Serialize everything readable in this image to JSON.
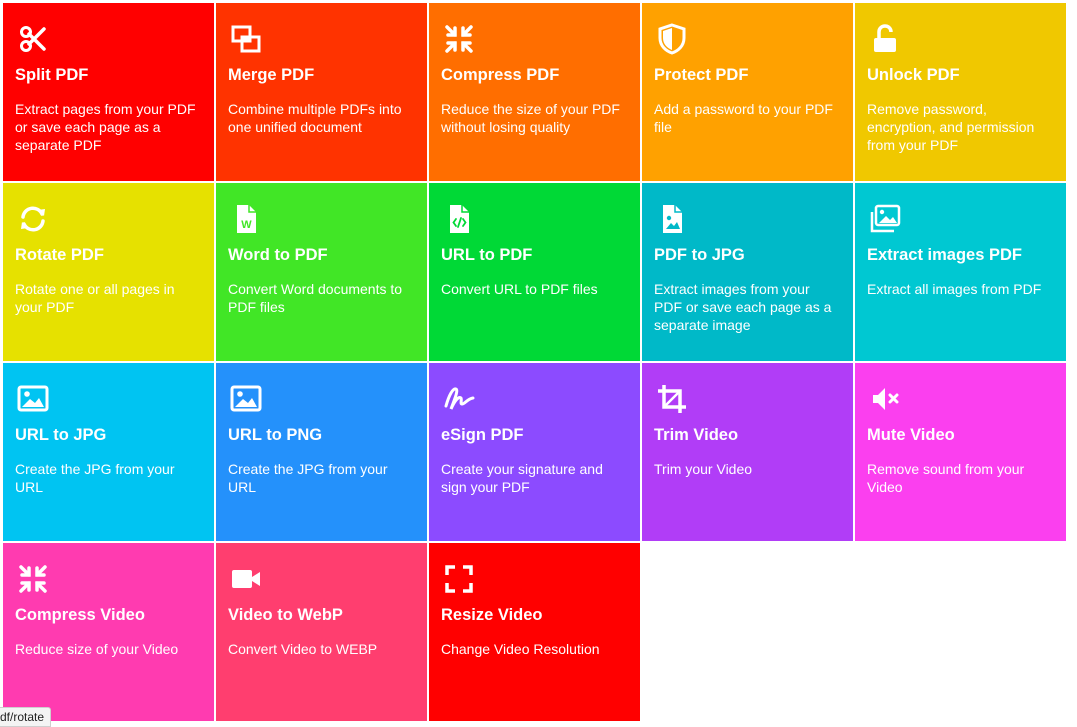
{
  "tiles": [
    {
      "title": "Split PDF",
      "desc": "Extract pages from your PDF or save each page as a separate PDF",
      "color": "#ff0000",
      "icon": "scissors-icon"
    },
    {
      "title": "Merge PDF",
      "desc": "Combine multiple PDFs into one unified document",
      "color": "#ff3300",
      "icon": "merge-icon"
    },
    {
      "title": "Compress PDF",
      "desc": "Reduce the size of your PDF without losing quality",
      "color": "#ff6e00",
      "icon": "compress-icon"
    },
    {
      "title": "Protect PDF",
      "desc": "Add a password to your PDF file",
      "color": "#ffa100",
      "icon": "shield-icon"
    },
    {
      "title": "Unlock PDF",
      "desc": "Remove password, encryption, and permission from your PDF",
      "color": "#f0c800",
      "icon": "unlock-icon"
    },
    {
      "title": "Rotate PDF",
      "desc": "Rotate one or all pages in your PDF",
      "color": "#e6e100",
      "icon": "rotate-icon"
    },
    {
      "title": "Word to PDF",
      "desc": "Convert Word documents to PDF files",
      "color": "#41e626",
      "icon": "word-file-icon"
    },
    {
      "title": "URL to PDF",
      "desc": "Convert URL to PDF files",
      "color": "#00d936",
      "icon": "code-file-icon"
    },
    {
      "title": "PDF to JPG",
      "desc": "Extract images from your PDF or save each page as a separate image",
      "color": "#00b9c8",
      "icon": "image-file-icon"
    },
    {
      "title": "Extract images PDF",
      "desc": "Extract all images from PDF",
      "color": "#00c8d2",
      "icon": "images-icon"
    },
    {
      "title": "URL to JPG",
      "desc": "Create the JPG from your URL",
      "color": "#00c4f2",
      "icon": "image-icon"
    },
    {
      "title": "URL to PNG",
      "desc": "Create the JPG from your URL",
      "color": "#2491fb",
      "icon": "image-icon"
    },
    {
      "title": "eSign PDF",
      "desc": "Create your signature and sign your PDF",
      "color": "#8c4bff",
      "icon": "signature-icon"
    },
    {
      "title": "Trim Video",
      "desc": "Trim your Video",
      "color": "#b13df7",
      "icon": "crop-icon"
    },
    {
      "title": "Mute Video",
      "desc": "Remove sound from your Video",
      "color": "#fb3fef",
      "icon": "mute-icon"
    },
    {
      "title": "Compress Video",
      "desc": "Reduce size of your Video",
      "color": "#ff3bb0",
      "icon": "compress-icon"
    },
    {
      "title": "Video to WebP",
      "desc": "Convert Video to WEBP",
      "color": "#ff3e6f",
      "icon": "video-camera-icon"
    },
    {
      "title": "Resize Video",
      "desc": "Change Video Resolution",
      "color": "#ff0000",
      "icon": "expand-icon"
    }
  ],
  "status_url": "df/rotate"
}
